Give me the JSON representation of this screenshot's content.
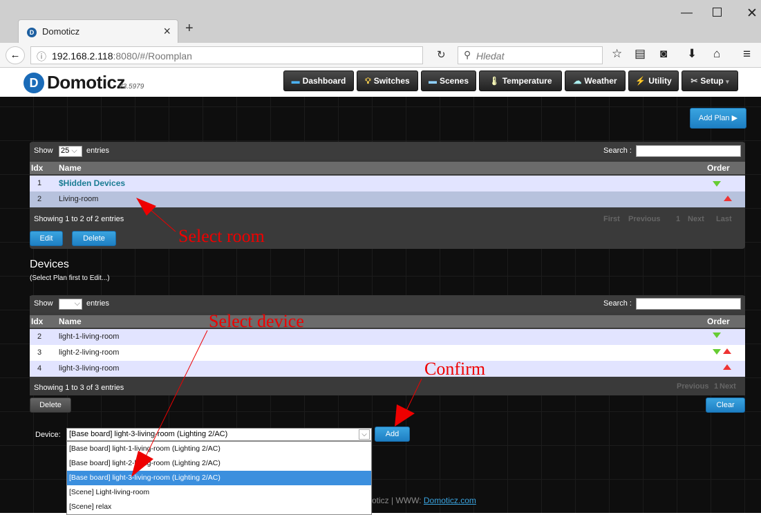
{
  "browser": {
    "tab_title": "Domoticz",
    "url_host": "192.168.2.118",
    "url_rest": ":8080/#/Roomplan",
    "search_placeholder": "Hledat"
  },
  "header": {
    "logo": "Domoticz",
    "version": "V3.5979",
    "nav": [
      "Dashboard",
      "Switches",
      "Scenes",
      "Temperature",
      "Weather",
      "Utility",
      "Setup"
    ]
  },
  "plans": {
    "add_plan_label": "Add Plan",
    "show_label": "Show",
    "show_value": "25",
    "entries_label": "entries",
    "search_label": "Search :",
    "col_idx": "Idx",
    "col_name": "Name",
    "col_order": "Order",
    "rows": [
      {
        "idx": "1",
        "name": "$Hidden Devices"
      },
      {
        "idx": "2",
        "name": "Living-room"
      }
    ],
    "info": "Showing 1 to 2 of 2 entries",
    "pager": {
      "first": "First",
      "previous": "Previous",
      "page": "1",
      "next": "Next",
      "last": "Last"
    },
    "edit_label": "Edit",
    "delete_label": "Delete"
  },
  "devices": {
    "title": "Devices",
    "subtitle": "(Select Plan first to Edit...)",
    "show_label": "Show",
    "entries_label": "entries",
    "search_label": "Search :",
    "col_idx": "Idx",
    "col_name": "Name",
    "col_order": "Order",
    "rows": [
      {
        "idx": "2",
        "name": "light-1-living-room"
      },
      {
        "idx": "3",
        "name": "light-2-living-room"
      },
      {
        "idx": "4",
        "name": "light-3-living-room"
      }
    ],
    "info": "Showing 1 to 3 of 3 entries",
    "pager": {
      "previous": "Previous",
      "page": "1",
      "next": "Next"
    },
    "delete_label": "Delete",
    "clear_label": "Clear"
  },
  "device_select": {
    "label": "Device:",
    "value": "[Base board] light-3-living-room (Lighting 2/AC)",
    "add_label": "Add",
    "options": [
      "[Base board] light-1-living-room (Lighting 2/AC)",
      "[Base board] light-2-living-room (Lighting 2/AC)",
      "[Base board] light-3-living-room (Lighting 2/AC)",
      "[Scene] Light-living-room",
      "[Scene] relax"
    ]
  },
  "footer": {
    "prefix": "oticz | WWW: ",
    "link": "Domoticz.com"
  },
  "annotations": {
    "select_room": "Select room",
    "select_device": "Select device",
    "confirm": "Confirm"
  }
}
